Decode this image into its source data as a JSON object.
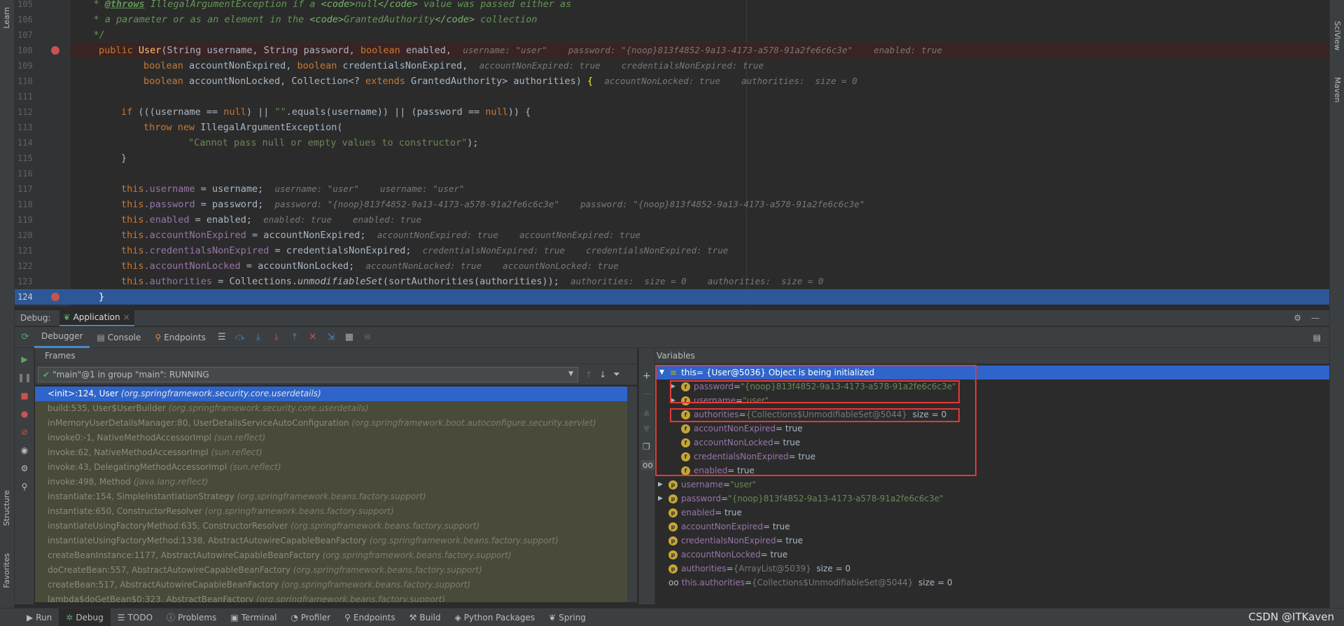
{
  "sidebar_left": {
    "learn": "Learn",
    "structure": "Structure",
    "favorites": "Favorites"
  },
  "sidebar_right": {
    "sciview": "SciView",
    "maven": "Maven"
  },
  "editor": {
    "line_numbers": [
      "105",
      "106",
      "107",
      "108",
      "109",
      "110",
      "111",
      "112",
      "113",
      "114",
      "115",
      "116",
      "117",
      "118",
      "119",
      "120",
      "121",
      "122",
      "123",
      "124"
    ],
    "lines": {
      "l105_a": "    * ",
      "l105_tag": "@throws",
      "l105_b": " IllegalArgumentException if a ",
      "l105_c1": "<code>",
      "l105_c2": "null",
      "l105_c3": "</code>",
      "l105_d": " value was passed either as",
      "l106_a": "    * a parameter or as an element in the ",
      "l106_c1": "<code>",
      "l106_c2": "GrantedAuthority",
      "l106_c3": "</code>",
      "l106_d": " collection",
      "l107": "    */",
      "l108_kw": "public ",
      "l108_fn": "User",
      "l108_a": "(String username, String password, ",
      "l108_kw2": "boolean",
      "l108_b": " enabled,  ",
      "l108_hint": "username: \"user\"    password: \"{noop}813f4852-9a13-4173-a578-91a2fe6c6c3e\"    enabled: true",
      "l109_kw": "boolean",
      "l109_a": " accountNonExpired, ",
      "l109_kw2": "boolean",
      "l109_b": " credentialsNonExpired,  ",
      "l109_hint": "accountNonExpired: true    credentialsNonExpired: true",
      "l110_kw": "boolean",
      "l110_a": " accountNonLocked, Collection<? ",
      "l110_kw2": "extends",
      "l110_b": " GrantedAuthority> authorities) ",
      "l110_brace": "{",
      "l110_hint": "accountNonLocked: true    authorities:  size = 0",
      "l112_kw": "if",
      "l112_a": " (((username == ",
      "l112_null": "null",
      "l112_b": ") || ",
      "l112_str": "\"\"",
      "l112_c": ".equals(username)) || (password == ",
      "l112_null2": "null",
      "l112_d": ")) {",
      "l113_kw": "throw new",
      "l113_a": " IllegalArgumentException(",
      "l114_str": "\"Cannot pass null or empty values to constructor\"",
      "l114_a": ");",
      "l115": "}",
      "l117_this": "this",
      "l117_fld": ".username",
      "l117_a": " = username;  ",
      "l117_hint": "username: \"user\"    username: \"user\"",
      "l118_this": "this",
      "l118_fld": ".password",
      "l118_a": " = password;  ",
      "l118_hint": "password: \"{noop}813f4852-9a13-4173-a578-91a2fe6c6c3e\"    password: \"{noop}813f4852-9a13-4173-a578-91a2fe6c6c3e\"",
      "l119_this": "this",
      "l119_fld": ".enabled",
      "l119_a": " = enabled;  ",
      "l119_hint": "enabled: true    enabled: true",
      "l120_this": "this",
      "l120_fld": ".accountNonExpired",
      "l120_a": " = accountNonExpired;  ",
      "l120_hint": "accountNonExpired: true    accountNonExpired: true",
      "l121_this": "this",
      "l121_fld": ".credentialsNonExpired",
      "l121_a": " = credentialsNonExpired;  ",
      "l121_hint": "credentialsNonExpired: true    credentialsNonExpired: true",
      "l122_this": "this",
      "l122_fld": ".accountNonLocked",
      "l122_a": " = accountNonLocked;  ",
      "l122_hint": "accountNonLocked: true    accountNonLocked: true",
      "l123_this": "this",
      "l123_fld": ".authorities",
      "l123_a": " = Collections.",
      "l123_it": "unmodifiableSet",
      "l123_b": "(sortAuthorities(authorities));  ",
      "l123_hint": "authorities:  size = 0    authorities:  size = 0",
      "l124": "}"
    }
  },
  "debug": {
    "label": "Debug:",
    "config_tab": "Application",
    "tabs": {
      "debugger": "Debugger",
      "console": "Console",
      "endpoints": "Endpoints"
    },
    "frames_title": "Frames",
    "thread": "\"main\"@1 in group \"main\": RUNNING",
    "frames": [
      {
        "m": "<init>:124, User ",
        "p": "(org.springframework.security.core.userdetails)"
      },
      {
        "m": "build:535, User$UserBuilder ",
        "p": "(org.springframework.security.core.userdetails)"
      },
      {
        "m": "inMemoryUserDetailsManager:80, UserDetailsServiceAutoConfiguration ",
        "p": "(org.springframework.boot.autoconfigure.security.servlet)"
      },
      {
        "m": "invoke0:-1, NativeMethodAccessorImpl ",
        "p": "(sun.reflect)"
      },
      {
        "m": "invoke:62, NativeMethodAccessorImpl ",
        "p": "(sun.reflect)"
      },
      {
        "m": "invoke:43, DelegatingMethodAccessorImpl ",
        "p": "(sun.reflect)"
      },
      {
        "m": "invoke:498, Method ",
        "p": "(java.lang.reflect)"
      },
      {
        "m": "instantiate:154, SimpleInstantiationStrategy ",
        "p": "(org.springframework.beans.factory.support)"
      },
      {
        "m": "instantiate:650, ConstructorResolver ",
        "p": "(org.springframework.beans.factory.support)"
      },
      {
        "m": "instantiateUsingFactoryMethod:635, ConstructorResolver ",
        "p": "(org.springframework.beans.factory.support)"
      },
      {
        "m": "instantiateUsingFactoryMethod:1338, AbstractAutowireCapableBeanFactory ",
        "p": "(org.springframework.beans.factory.support)"
      },
      {
        "m": "createBeanInstance:1177, AbstractAutowireCapableBeanFactory ",
        "p": "(org.springframework.beans.factory.support)"
      },
      {
        "m": "doCreateBean:557, AbstractAutowireCapableBeanFactory ",
        "p": "(org.springframework.beans.factory.support)"
      },
      {
        "m": "createBean:517, AbstractAutowireCapableBeanFactory ",
        "p": "(org.springframework.beans.factory.support)"
      },
      {
        "m": "lambda$doGetBean$0:323, AbstractBeanFactory ",
        "p": "(org.springframework.beans.factory.support)"
      }
    ],
    "variables_title": "Variables",
    "vars": {
      "this_name": "this",
      "this_val": " = {User@5036} Object is being initialized",
      "pw_name": "password",
      "pw_val": "\"{noop}813f4852-9a13-4173-a578-91a2fe6c6c3e\"",
      "un_name": "username",
      "un_val": "\"user\"",
      "au_name": "authorities",
      "au_val": "{Collections$UnmodifiableSet@5044}",
      "au_size": "size = 0",
      "ane_name": "accountNonExpired",
      "ane_val": " = true",
      "anl_name": "accountNonLocked",
      "anl_val": " = true",
      "cne_name": "credentialsNonExpired",
      "cne_val": " = true",
      "en_name": "enabled",
      "en_val": " = true",
      "p_un_name": "username",
      "p_un_val": "\"user\"",
      "p_pw_name": "password",
      "p_pw_val": "\"{noop}813f4852-9a13-4173-a578-91a2fe6c6c3e\"",
      "p_en_name": "enabled",
      "p_en_val": " = true",
      "p_ane_name": "accountNonExpired",
      "p_ane_val": " = true",
      "p_cne_name": "credentialsNonExpired",
      "p_cne_val": " = true",
      "p_anl_name": "accountNonLocked",
      "p_anl_val": " = true",
      "p_au_name": "authorities",
      "p_au_val": "{ArrayList@5039}",
      "p_au_size": "size = 0",
      "ta_name": "this.authorities",
      "ta_val": "{Collections$UnmodifiableSet@5044}",
      "ta_size": "size = 0",
      "eq": " = "
    }
  },
  "toolwindows": {
    "run": "Run",
    "debug": "Debug",
    "todo": "TODO",
    "problems": "Problems",
    "terminal": "Terminal",
    "profiler": "Profiler",
    "endpoints": "Endpoints",
    "build": "Build",
    "python": "Python Packages",
    "spring": "Spring"
  },
  "watermark": "CSDN @ITKaven",
  "colors": {
    "accent": "#2f65ca",
    "breakpoint": "#c75450",
    "annotation_box": "#e53935"
  }
}
